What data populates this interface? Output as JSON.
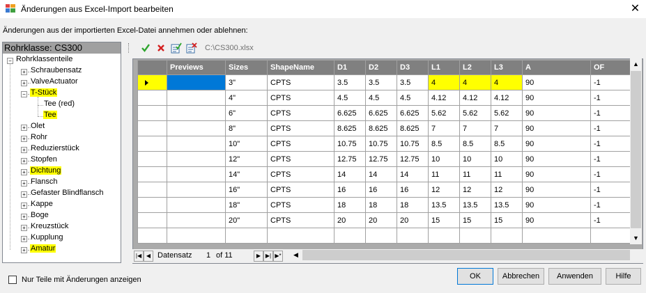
{
  "window": {
    "title": "Änderungen aus Excel-Import bearbeiten",
    "close_glyph": "✕"
  },
  "instruction": "Änderungen aus der importierten Excel-Datei annehmen oder ablehnen:",
  "tree": {
    "header": "Rohrklasse: CS300",
    "root": "Rohrklassenteile",
    "items": [
      {
        "label": "Schraubensatz",
        "highlighted": false
      },
      {
        "label": "ValveActuator",
        "highlighted": false
      },
      {
        "label": "T-Stück",
        "highlighted": true,
        "expanded": true,
        "children": [
          {
            "label": "Tee (red)",
            "highlighted": false
          },
          {
            "label": "Tee",
            "highlighted": true
          }
        ]
      },
      {
        "label": "Olet",
        "highlighted": false
      },
      {
        "label": "Rohr",
        "highlighted": false
      },
      {
        "label": "Reduzierstück",
        "highlighted": false
      },
      {
        "label": "Stopfen",
        "highlighted": false
      },
      {
        "label": "Dichtung",
        "highlighted": true
      },
      {
        "label": "Flansch",
        "highlighted": false
      },
      {
        "label": "Gefaster Blindflansch",
        "highlighted": false
      },
      {
        "label": "Kappe",
        "highlighted": false
      },
      {
        "label": "Boge",
        "highlighted": false
      },
      {
        "label": "Kreuzstück",
        "highlighted": false
      },
      {
        "label": "Kupplung",
        "highlighted": false
      },
      {
        "label": "Amatur",
        "highlighted": true
      }
    ]
  },
  "toolbar": {
    "buttons": [
      {
        "name": "accept-icon",
        "glyph": "✔",
        "color": "#2e9e2e"
      },
      {
        "name": "reject-icon",
        "glyph": "✖",
        "color": "#d42020"
      },
      {
        "name": "accept-all-icon",
        "glyph": "✎",
        "color": "#3a6ea5"
      },
      {
        "name": "reject-all-icon",
        "glyph": "✎",
        "color": "#b03030"
      }
    ],
    "file_path": "C:\\CS300.xlsx"
  },
  "grid": {
    "columns": [
      "Previews",
      "Sizes",
      "ShapeName",
      "D1",
      "D2",
      "D3",
      "L1",
      "L2",
      "L3",
      "A",
      "OF"
    ],
    "rows": [
      [
        "",
        "3\"",
        "CPTS",
        "3.5",
        "3.5",
        "3.5",
        "4",
        "4",
        "4",
        "90",
        "-1"
      ],
      [
        "",
        "4\"",
        "CPTS",
        "4.5",
        "4.5",
        "4.5",
        "4.12",
        "4.12",
        "4.12",
        "90",
        "-1"
      ],
      [
        "",
        "6\"",
        "CPTS",
        "6.625",
        "6.625",
        "6.625",
        "5.62",
        "5.62",
        "5.62",
        "90",
        "-1"
      ],
      [
        "",
        "8\"",
        "CPTS",
        "8.625",
        "8.625",
        "8.625",
        "7",
        "7",
        "7",
        "90",
        "-1"
      ],
      [
        "",
        "10\"",
        "CPTS",
        "10.75",
        "10.75",
        "10.75",
        "8.5",
        "8.5",
        "8.5",
        "90",
        "-1"
      ],
      [
        "",
        "12\"",
        "CPTS",
        "12.75",
        "12.75",
        "12.75",
        "10",
        "10",
        "10",
        "90",
        "-1"
      ],
      [
        "",
        "14\"",
        "CPTS",
        "14",
        "14",
        "14",
        "11",
        "11",
        "11",
        "90",
        "-1"
      ],
      [
        "",
        "16\"",
        "CPTS",
        "16",
        "16",
        "16",
        "12",
        "12",
        "12",
        "90",
        "-1"
      ],
      [
        "",
        "18\"",
        "CPTS",
        "18",
        "18",
        "18",
        "13.5",
        "13.5",
        "13.5",
        "90",
        "-1"
      ],
      [
        "",
        "20\"",
        "CPTS",
        "20",
        "20",
        "20",
        "15",
        "15",
        "15",
        "90",
        "-1"
      ]
    ],
    "highlight_color": "#ffff00",
    "selection_color": "#0078d7"
  },
  "navigator": {
    "label": "Datensatz",
    "position": "1",
    "of_text": "of 11"
  },
  "footer": {
    "checkbox_label": "Nur Teile mit Änderungen anzeigen",
    "checkbox_checked": false,
    "buttons": {
      "ok": "OK",
      "cancel": "Abbrechen",
      "apply": "Anwenden",
      "help": "Hilfe"
    }
  }
}
